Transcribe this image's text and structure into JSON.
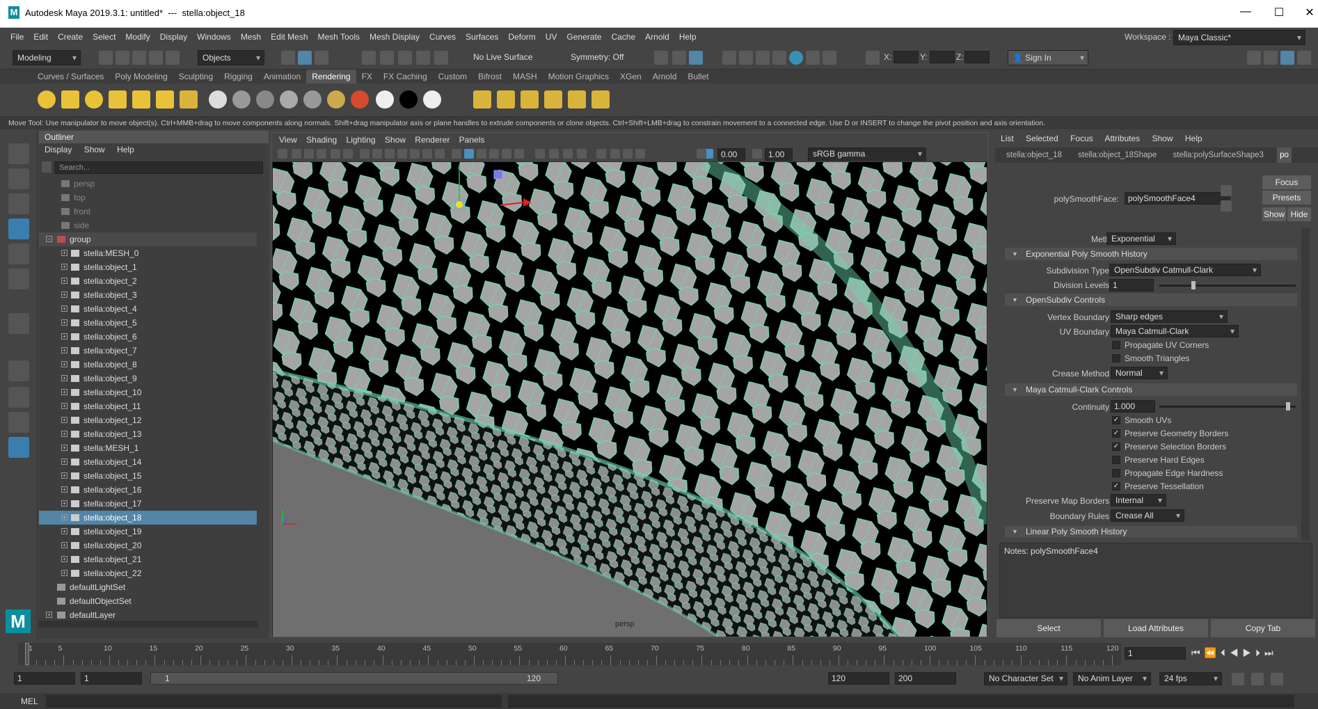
{
  "title": {
    "app": "Autodesk Maya 2019.3.1: untitled*",
    "sep": "---",
    "object": "stella:object_18",
    "minimize": "—",
    "maximize": "☐",
    "close": "✕"
  },
  "menu": [
    "File",
    "Edit",
    "Create",
    "Select",
    "Modify",
    "Display",
    "Windows",
    "Mesh",
    "Edit Mesh",
    "Mesh Tools",
    "Mesh Display",
    "Curves",
    "Surfaces",
    "Deform",
    "UV",
    "Generate",
    "Cache",
    "Arnold",
    "Help"
  ],
  "workspace": {
    "label": "Workspace :",
    "value": "Maya Classic*"
  },
  "statusline": {
    "mode": "Modeling",
    "objects": "Objects",
    "live_surface": "No Live Surface",
    "symmetry": "Symmetry: Off",
    "x_label": "X:",
    "y_label": "Y:",
    "z_label": "Z:",
    "sign_in": "Sign In"
  },
  "shelf_tabs": [
    "Curves / Surfaces",
    "Poly Modeling",
    "Sculpting",
    "Rigging",
    "Animation",
    "Rendering",
    "FX",
    "FX Caching",
    "Custom",
    "Bifrost",
    "MASH",
    "Motion Graphics",
    "XGen",
    "Arnold",
    "Bullet"
  ],
  "shelf_active": "Rendering",
  "help_line": "Move Tool: Use manipulator to move object(s). Ctrl+MMB+drag to move components along normals. Shift+drag manipulator axis or plane handles to extrude components or clone objects. Ctrl+Shift+LMB+drag to constrain movement to a connected edge. Use D or INSERT to change the pivot position and axis orientation.",
  "outliner": {
    "title": "Outliner",
    "menu": [
      "Display",
      "Show",
      "Help"
    ],
    "search_placeholder": "Search...",
    "cameras": [
      "persp",
      "top",
      "front",
      "side"
    ],
    "group": "group",
    "children": [
      "stella:MESH_0",
      "stella:object_1",
      "stella:object_2",
      "stella:object_3",
      "stella:object_4",
      "stella:object_5",
      "stella:object_6",
      "stella:object_7",
      "stella:object_8",
      "stella:object_9",
      "stella:object_10",
      "stella:object_11",
      "stella:object_12",
      "stella:object_13",
      "stella:MESH_1",
      "stella:object_14",
      "stella:object_15",
      "stella:object_16",
      "stella:object_17",
      "stella:object_18",
      "stella:object_19",
      "stella:object_20",
      "stella:object_21",
      "stella:object_22"
    ],
    "selected": "stella:object_18",
    "sets": [
      "defaultLightSet",
      "defaultObjectSet",
      "defaultLayer"
    ]
  },
  "viewport": {
    "menu": [
      "View",
      "Shading",
      "Lighting",
      "Show",
      "Renderer",
      "Panels"
    ],
    "exposure": "0.00",
    "gamma": "1.00",
    "colorspace": "sRGB gamma",
    "camera_label": "persp"
  },
  "attr": {
    "menu": [
      "List",
      "Selected",
      "Focus",
      "Attributes",
      "Show",
      "Help"
    ],
    "tabs": [
      "stella:object_18",
      "stella:object_18Shape",
      "stella:polySurfaceShape3",
      "po"
    ],
    "active_tab": "po",
    "node_label": "polySmoothFace:",
    "node_value": "polySmoothFace4",
    "buttons": {
      "focus": "Focus",
      "presets": "Presets",
      "show": "Show",
      "hide": "Hide"
    },
    "method_label": "Method",
    "method_value": "Exponential",
    "sec_exp": "Exponential Poly Smooth History",
    "subdiv_type_label": "Subdivision Type",
    "subdiv_type_value": "OpenSubdiv Catmull-Clark",
    "division_label": "Division Levels",
    "division_value": "1",
    "sec_osd": "OpenSubdiv Controls",
    "vertex_boundary_label": "Vertex Boundary",
    "vertex_boundary_value": "Sharp edges",
    "uv_boundary_label": "UV Boundary",
    "uv_boundary_value": "Maya Catmull-Clark",
    "propagate_uv": "Propagate UV Corners",
    "smooth_tri": "Smooth Triangles",
    "crease_label": "Crease Method",
    "crease_value": "Normal",
    "sec_mcc": "Maya Catmull-Clark Controls",
    "continuity_label": "Continuity",
    "continuity_value": "1.000",
    "checks": [
      {
        "label": "Smooth UVs",
        "on": "✓"
      },
      {
        "label": "Preserve Geometry Borders",
        "on": "✓"
      },
      {
        "label": "Preserve Selection Borders",
        "on": "✓"
      },
      {
        "label": "Preserve Hard Edges",
        "on": ""
      },
      {
        "label": "Propagate Edge Hardness",
        "on": ""
      },
      {
        "label": "Preserve Tessellation",
        "on": "✓"
      }
    ],
    "map_borders_label": "Preserve Map Borders",
    "map_borders_value": "Internal",
    "boundary_rules_label": "Boundary Rules",
    "boundary_rules_value": "Crease All",
    "sec_linear": "Linear Poly Smooth History",
    "notes_label": "Notes:",
    "notes_value": "polySmoothFace4",
    "bottom": {
      "select": "Select",
      "load": "Load Attributes",
      "copy": "Copy Tab"
    }
  },
  "timeline": {
    "ticks": [
      "1",
      "5",
      "10",
      "15",
      "20",
      "25",
      "30",
      "35",
      "40",
      "45",
      "50",
      "55",
      "60",
      "65",
      "70",
      "75",
      "80",
      "85",
      "90",
      "95",
      "100",
      "105",
      "110",
      "115",
      "120"
    ],
    "current": "1"
  },
  "range": {
    "start": "1",
    "start2": "1",
    "slider_start": "1",
    "slider_end": "120",
    "end": "120",
    "end2": "200",
    "char_set": "No Character Set",
    "anim_layer": "No Anim Layer",
    "fps": "24 fps"
  },
  "cmd": {
    "mel": "MEL"
  }
}
